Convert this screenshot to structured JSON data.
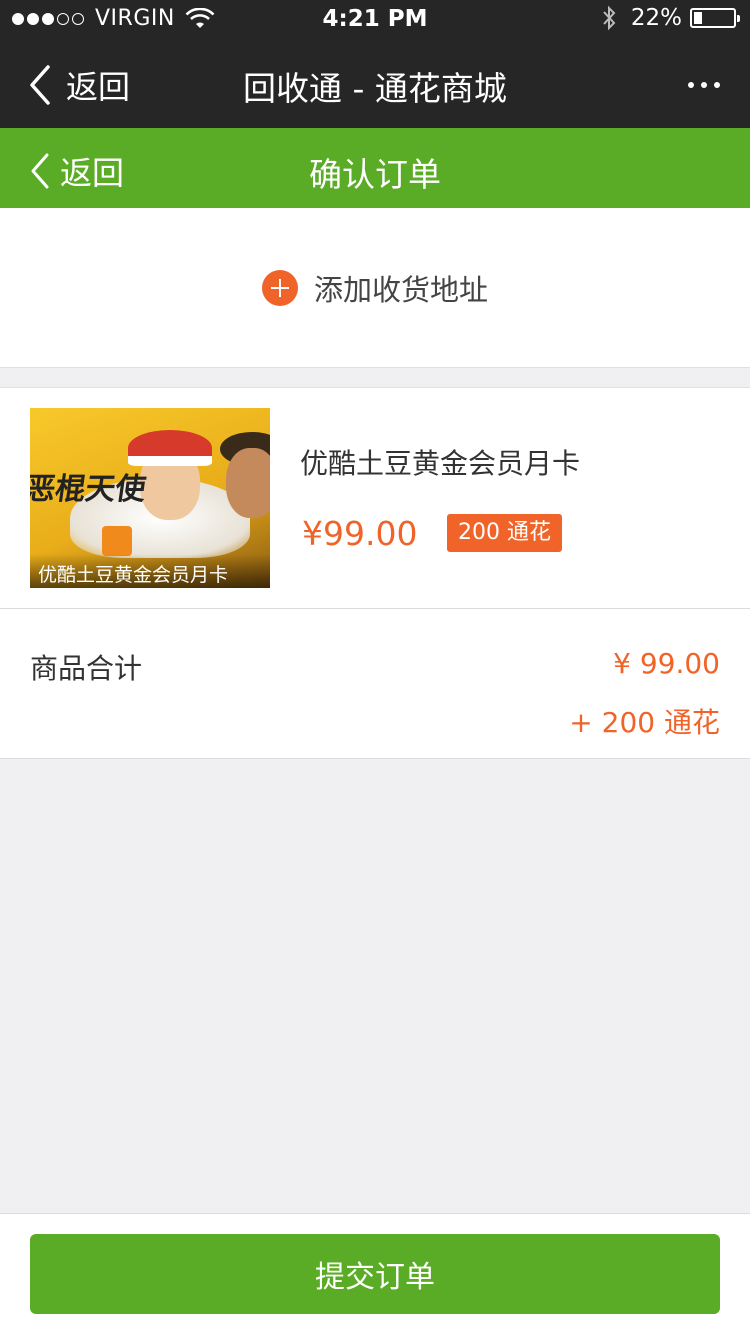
{
  "status_bar": {
    "carrier": "VIRGIN",
    "time": "4:21 PM",
    "battery_percent": "22%",
    "battery_level": 0.22,
    "signal_bars_filled": 3,
    "signal_bars_total": 5
  },
  "nav": {
    "back_label": "返回",
    "title": "回收通 - 通花商城"
  },
  "subnav": {
    "back_label": "返回",
    "title": "确认订单"
  },
  "address": {
    "add_label": "添加收货地址"
  },
  "product": {
    "name": "优酷土豆黄金会员月卡",
    "price": "¥99.00",
    "points_tag": "200 通花",
    "thumbnail_caption": "优酷土豆黄金会员月卡",
    "thumbnail_logo_text": "恶棍天使"
  },
  "totals": {
    "label": "商品合计",
    "price": "¥ 99.00",
    "points": "+ 200 通花"
  },
  "footer": {
    "submit_label": "提交订单"
  },
  "colors": {
    "brand_green": "#5aab25",
    "accent_orange": "#f0642a",
    "dark_bar": "#262626"
  }
}
